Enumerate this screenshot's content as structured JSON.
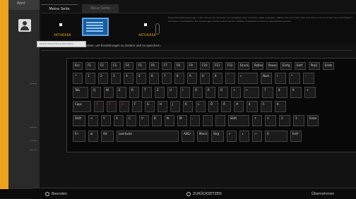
{
  "sidebar": {
    "selected_label": "Wort"
  },
  "tabs": [
    {
      "label": "Meine Seite"
    },
    {
      "label": "Neue Seite"
    }
  ],
  "toggles": [
    {
      "label": "AKTIVIEREN"
    },
    {
      "label": "AKTIVIEREN"
    }
  ],
  "info_text": "Beleuchtungsanpassungen | Hier können Sie die Farbe und Helligkeit jeder einzelnen Taste einstellen. Wählen Sie eine Taste oder eine Zone aus und ändern Sie anschließend die Farbe im Farbwähler. Die Änderungen werden sofort auf der Tastatur angezeigt und können gespeichert werden.",
  "tooltip": {
    "text": "Tastaturbeleuchtung bearbeiten"
  },
  "instruction": "Wählen Sie die Taste, die Sie drücken, um Einstellungen zu ändern und zu speichern.",
  "keyboard": {
    "row1": [
      "Esc",
      "F1",
      "F2",
      "F3",
      "F4",
      "F5",
      "F6",
      "F7",
      "F8",
      "F9",
      "F10",
      "F11",
      "F12",
      "Druck",
      "Rollen",
      "Pause",
      "Einfg",
      "Entf",
      "Pos1",
      "Ende"
    ],
    "row2": [
      "^",
      "1",
      "2",
      "3",
      "4",
      "5",
      "6",
      "7",
      "8",
      "9",
      "0",
      "ß",
      "´",
      "←",
      "Num",
      "/",
      "*",
      "-"
    ],
    "row3": [
      "Tab",
      "Q",
      "W",
      "E",
      "R",
      "T",
      "Z",
      "U",
      "I",
      "O",
      "P",
      "Ü",
      "+",
      "↵",
      "7",
      "8",
      "9",
      "+"
    ],
    "row4": [
      "Caps",
      "A",
      "S",
      "D",
      "F",
      "G",
      "H",
      "J",
      "K",
      "L",
      "Ö",
      "Ä",
      "#",
      "4",
      "5",
      "6"
    ],
    "row5": [
      "Shift",
      "<",
      "Y",
      "X",
      "C",
      "V",
      "B",
      "N",
      "M",
      ",",
      ".",
      "-",
      "Shift",
      "↑",
      "1",
      "2",
      "3",
      "Enter"
    ],
    "row6": [
      "Fn",
      "⊞",
      "Alt",
      "Leertaste",
      "AltGr",
      "Menü",
      "Strg",
      "←",
      "↓",
      "→",
      "0",
      "Entf"
    ]
  },
  "footer": {
    "exit_label": "Beenden",
    "reset_label": "ZURÜCKSETZEN",
    "right_label": "Übernehmen"
  }
}
